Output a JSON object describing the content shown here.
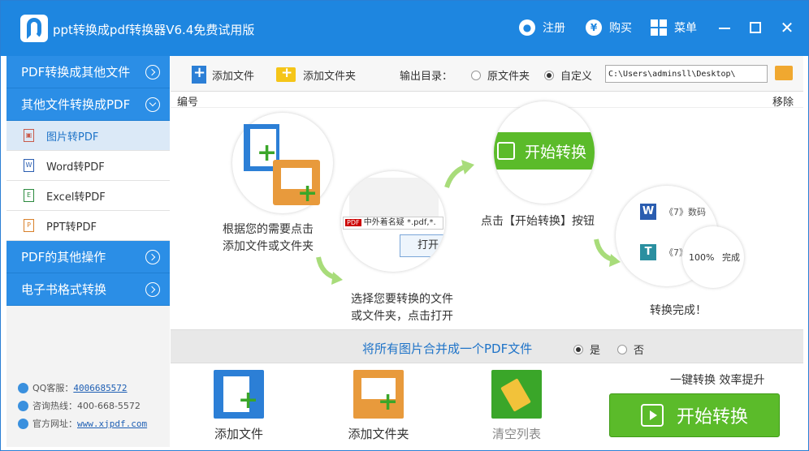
{
  "app": {
    "title": "ppt转换成pdf转换器V6.4免费试用版",
    "register_label": "注册",
    "buy_label": "购买",
    "menu_label": "菜单"
  },
  "sidebar": {
    "categories": [
      {
        "label": "PDF转换成其他文件"
      },
      {
        "label": "其他文件转换成PDF"
      }
    ],
    "items": [
      {
        "label": "图片转PDF",
        "icon": "image-file-icon"
      },
      {
        "label": "Word转PDF",
        "icon": "word-file-icon"
      },
      {
        "label": "Excel转PDF",
        "icon": "excel-file-icon"
      },
      {
        "label": "PPT转PDF",
        "icon": "ppt-file-icon"
      }
    ],
    "categories_bottom": [
      {
        "label": "PDF的其他操作"
      },
      {
        "label": "电子书格式转换"
      }
    ],
    "contact": {
      "qq_label": "QQ客服：",
      "qq_value": "4006685572",
      "phone_label": "咨询热线：",
      "phone_value": "400-668-5572",
      "site_label": "官方网址：",
      "site_value": "www.xjpdf.com"
    }
  },
  "toolbar": {
    "add_file_label": "添加文件",
    "add_folder_label": "添加文件夹",
    "output_label": "输出目录：",
    "radio_source": "原文件夹",
    "radio_custom": "自定义",
    "output_path": "C:\\Users\\adminsll\\Desktop\\"
  },
  "list_header": {
    "number": "编号",
    "remove": "移除"
  },
  "guide": {
    "step1": "根据您的需要点击\n添加文件或文件夹",
    "step2": "选择您要转换的文件\n或文件夹，点击打开",
    "step3": "点击【开始转换】按钮",
    "step4": "转换完成！",
    "bubble_start_label": "开始转换",
    "bubble_open_label": "打开",
    "bubble_file_text": "中外着名疑",
    "bubble_filter_text": "*.pdf,*.",
    "bubble_item1": "《7》数码",
    "bubble_item2": "《7》",
    "bubble_progress": "100%",
    "bubble_done": "完成"
  },
  "merge": {
    "text": "将所有图片合并成一个PDF文件",
    "yes": "是",
    "no": "否"
  },
  "bottom": {
    "add_file": "添加文件",
    "add_folder": "添加文件夹",
    "clear_list": "清空列表",
    "slogan": "一键转换  效率提升",
    "start": "开始转换"
  },
  "colors": {
    "primary": "#1e86e0",
    "sidebar_blue": "#2b8ee6",
    "green": "#5bbb2a",
    "merge_text": "#1e73c8"
  }
}
